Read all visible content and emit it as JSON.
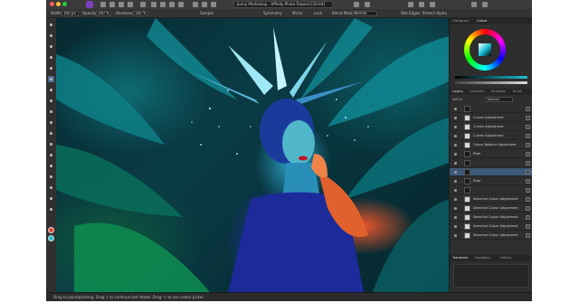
{
  "window": {
    "document_tab": "Jonny Photoshop - Affinity Photo Tropical [16-bit]",
    "accent_color": "#7d3fbe"
  },
  "context_bar": {
    "width_label": "Width",
    "width_value": "100 px",
    "opacity_label": "Opacity",
    "opacity_value": "100 %",
    "hardness_label": "Hardness",
    "hardness_value": "100 %",
    "sample_label": "Sample",
    "symmetry_label": "Symmetry",
    "mirror_label": "Mirror",
    "lock_label": "Lock",
    "blend_label": "Blend Mode",
    "blend_value": "Normal",
    "wet_edges_label": "Wet Edges",
    "protect_label": "Protect Alpha"
  },
  "tools": [
    "move-tool-icon",
    "view-tool-icon",
    "crop-tool-icon",
    "selection-brush-icon",
    "flood-select-icon",
    "paint-brush-icon",
    "erase-brush-icon",
    "fill-tool-icon",
    "clone-brush-icon",
    "dodge-brush-icon",
    "healing-brush-icon",
    "blemish-remover-icon",
    "red-eye-icon",
    "pen-tool-icon",
    "shape-tool-icon",
    "text-tool-icon",
    "gradient-tool-icon",
    "zoom-tool-icon"
  ],
  "colors": {
    "primary": "#e64a2e",
    "secondary": "#19c3d8"
  },
  "panels": {
    "color_tabs": [
      "Histogram",
      "Colour"
    ],
    "layers_tabs": [
      "Layers",
      "Channels",
      "Shadows",
      "Brush"
    ],
    "opacity_value": "100 %",
    "blend_value": "Normal",
    "layers": [
      {
        "name": "",
        "thumb": "dark",
        "selected": false
      },
      {
        "name": "Curves Adjustment",
        "thumb": "light",
        "selected": false
      },
      {
        "name": "Curves Adjustment",
        "thumb": "light",
        "selected": false
      },
      {
        "name": "Curves Adjustment",
        "thumb": "light",
        "selected": false
      },
      {
        "name": "Colour Balance Adjustment",
        "thumb": "light",
        "selected": false
      },
      {
        "name": "Pixel",
        "thumb": "dark",
        "selected": false
      },
      {
        "name": "",
        "thumb": "dark",
        "selected": false
      },
      {
        "name": "",
        "thumb": "dark",
        "selected": true
      },
      {
        "name": "Pixel",
        "thumb": "dark",
        "selected": false
      },
      {
        "name": "",
        "thumb": "dark",
        "selected": false
      },
      {
        "name": "Selective Colour Adjustment",
        "thumb": "light",
        "selected": false
      },
      {
        "name": "Selective Colour Adjustment",
        "thumb": "light",
        "selected": false
      },
      {
        "name": "Selective Colour Adjustment",
        "thumb": "light",
        "selected": false
      },
      {
        "name": "Selective Colour Adjustment",
        "thumb": "light",
        "selected": false
      },
      {
        "name": "Selective Colour Adjustment",
        "thumb": "light",
        "selected": false
      }
    ],
    "bottom_tabs": [
      "Transform",
      "Navigator",
      "History"
    ]
  },
  "status": {
    "text": "Drag to paint/painting. Drag ⇧ to continue last stroke. Drag ⌥ to use colour picker."
  }
}
